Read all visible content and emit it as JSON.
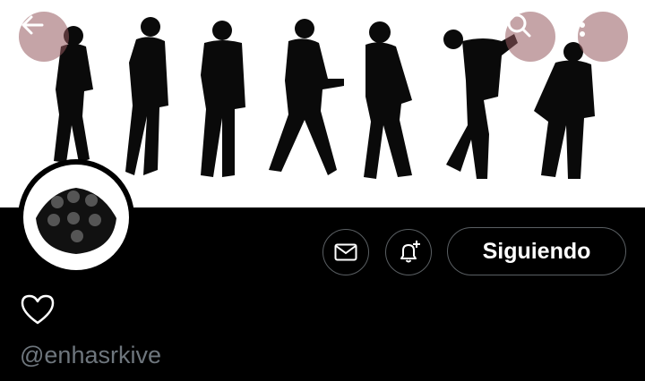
{
  "profile": {
    "handle": "@enhasrkive",
    "follow_label": "Siguiendo"
  },
  "icons": {
    "back": "arrow-left-icon",
    "search": "search-icon",
    "more": "more-vertical-icon",
    "message": "envelope-icon",
    "notify": "bell-plus-icon",
    "like": "heart-icon"
  },
  "colors": {
    "background": "#000000",
    "banner_background": "#ffffff",
    "overlay_button": "#965a5f",
    "button_border": "#5a5f63",
    "handle_text": "#6e767d",
    "text": "#ffffff"
  }
}
